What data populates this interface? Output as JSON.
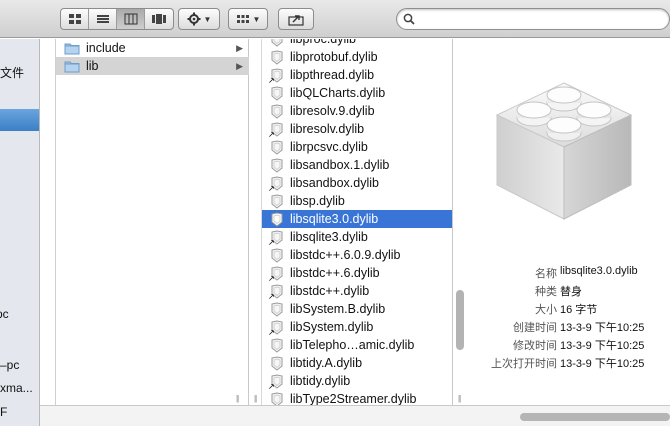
{
  "toolbar": {
    "view_buttons": [
      "icon-view",
      "list-view",
      "column-view",
      "cover-flow-view"
    ],
    "active_view": "column-view",
    "search": {
      "value": "",
      "placeholder": ""
    }
  },
  "sidebar": {
    "items": [
      {
        "label": "文件"
      },
      {
        "label": "pc"
      },
      {
        "label": "–pc"
      },
      {
        "label": "xma..."
      },
      {
        "label": "F"
      }
    ]
  },
  "column1": {
    "items": [
      {
        "label": "include",
        "selected": false
      },
      {
        "label": "lib",
        "selected": true
      }
    ]
  },
  "column2": {
    "items": [
      {
        "label": "libproc.dylib",
        "alias": false
      },
      {
        "label": "libprotobuf.dylib",
        "alias": false
      },
      {
        "label": "libpthread.dylib",
        "alias": true
      },
      {
        "label": "libQLCharts.dylib",
        "alias": false
      },
      {
        "label": "libresolv.9.dylib",
        "alias": false
      },
      {
        "label": "libresolv.dylib",
        "alias": true
      },
      {
        "label": "librpcsvc.dylib",
        "alias": false
      },
      {
        "label": "libsandbox.1.dylib",
        "alias": false
      },
      {
        "label": "libsandbox.dylib",
        "alias": true
      },
      {
        "label": "libsp.dylib",
        "alias": false
      },
      {
        "label": "libsqlite3.0.dylib",
        "alias": false,
        "selected": true
      },
      {
        "label": "libsqlite3.dylib",
        "alias": true
      },
      {
        "label": "libstdc++.6.0.9.dylib",
        "alias": false
      },
      {
        "label": "libstdc++.6.dylib",
        "alias": true
      },
      {
        "label": "libstdc++.dylib",
        "alias": true
      },
      {
        "label": "libSystem.B.dylib",
        "alias": false
      },
      {
        "label": "libSystem.dylib",
        "alias": true
      },
      {
        "label": "libTelepho…amic.dylib",
        "alias": false
      },
      {
        "label": "libtidy.A.dylib",
        "alias": false
      },
      {
        "label": "libtidy.dylib",
        "alias": true
      },
      {
        "label": "libType2Streamer.dylib",
        "alias": false
      }
    ]
  },
  "preview": {
    "info": [
      {
        "key": "名称",
        "value": "libsqlite3.0.dylib"
      },
      {
        "key": "种类",
        "value": "替身"
      },
      {
        "key": "大小",
        "value": "16 字节"
      },
      {
        "key": "创建时间",
        "value": "13-3-9 下午10:25"
      },
      {
        "key": "修改时间",
        "value": "13-3-9 下午10:25"
      },
      {
        "key": "上次打开时间",
        "value": "13-3-9 下午10:25"
      }
    ]
  },
  "colors": {
    "selection": "#3875d7",
    "inactive_selection": "#d4d4d4",
    "sidebar_selection": "#3b7fc7"
  }
}
